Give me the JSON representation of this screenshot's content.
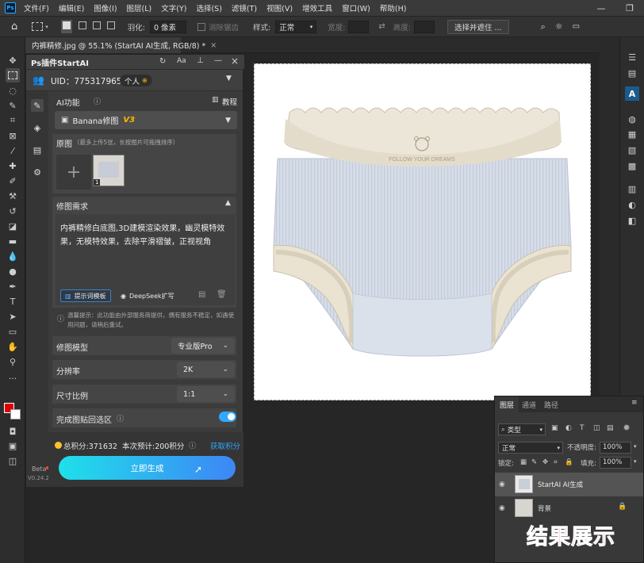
{
  "app": {
    "menu": [
      "文件(F)",
      "编辑(E)",
      "图像(I)",
      "图层(L)",
      "文字(Y)",
      "选择(S)",
      "滤镜(T)",
      "视图(V)",
      "增效工具",
      "窗口(W)",
      "帮助(H)"
    ],
    "logo": "Ps",
    "options": {
      "feather_label": "羽化:",
      "feather_value": "0 像素",
      "antialias_label": "消除锯齿",
      "style_label": "样式:",
      "style_value": "正常",
      "width_label": "宽度:",
      "height_label": "高度:",
      "select_mask_button": "选择并遮住 ..."
    },
    "doc_tab": "内裤精修.jpg @ 55.1% (StartAI AI生成, RGB/8) *"
  },
  "plugin": {
    "title": "Ps插件StartAI",
    "uid": "UID：775317965",
    "account_type": "个人",
    "ai_function_label": "AI功能",
    "tutorial_label": "教程",
    "model_select": "Banana修图",
    "model_badge": "V3",
    "original_label": "原图",
    "original_hint": "（最多上传5张，长按图片可拖拽排序）",
    "thumb_count": "1",
    "requirement_label": "修图需求",
    "requirement_text": "内裤精修白底图,3D建模渲染效果，幽灵模特效果，无模特效果，去除平滑褶皱，正视视角",
    "prompt_template_button": "提示词模板",
    "deepseek_button": "DeepSeek扩写",
    "notice": "温馨提示：此功能由外部服务商提供，偶有服务不稳定，如遇使用问题，请稍后重试。",
    "retouch_model_label": "修图模型",
    "retouch_model_value": "专业版Pro",
    "resolution_label": "分辨率",
    "resolution_value": "2K",
    "ratio_label": "尺寸比例",
    "ratio_value": "1:1",
    "paste_back_label": "完成图贴回选区",
    "paste_back_on": true,
    "points_total": "总积分:371632",
    "points_estimate": "本次预计:200积分",
    "get_points": "获取积分",
    "generate_button": "立即生成",
    "beta_label": "Beta",
    "version": "V0.24.2"
  },
  "canvas": {
    "waistband_text": "FOLLOW YOUR DREAMS"
  },
  "layers_panel": {
    "tabs": [
      "图层",
      "通道",
      "路径"
    ],
    "filter_kind": "类型",
    "blend_mode": "正常",
    "opacity_label": "不透明度:",
    "opacity_value": "100%",
    "lock_label": "锁定:",
    "fill_label": "填充:",
    "fill_value": "100%",
    "layers": [
      {
        "name": "StartAI AI生成",
        "selected": true
      },
      {
        "name": "背景",
        "locked": true
      }
    ]
  },
  "overlay_caption": "结果展示",
  "colors": {
    "accent_blue": "#31a8ff",
    "generate_gradient_start": "#1fe0ea",
    "generate_gradient_end": "#3d86f6",
    "caption_red": "#ff1a1a",
    "badge_yellow": "#ffb400"
  }
}
